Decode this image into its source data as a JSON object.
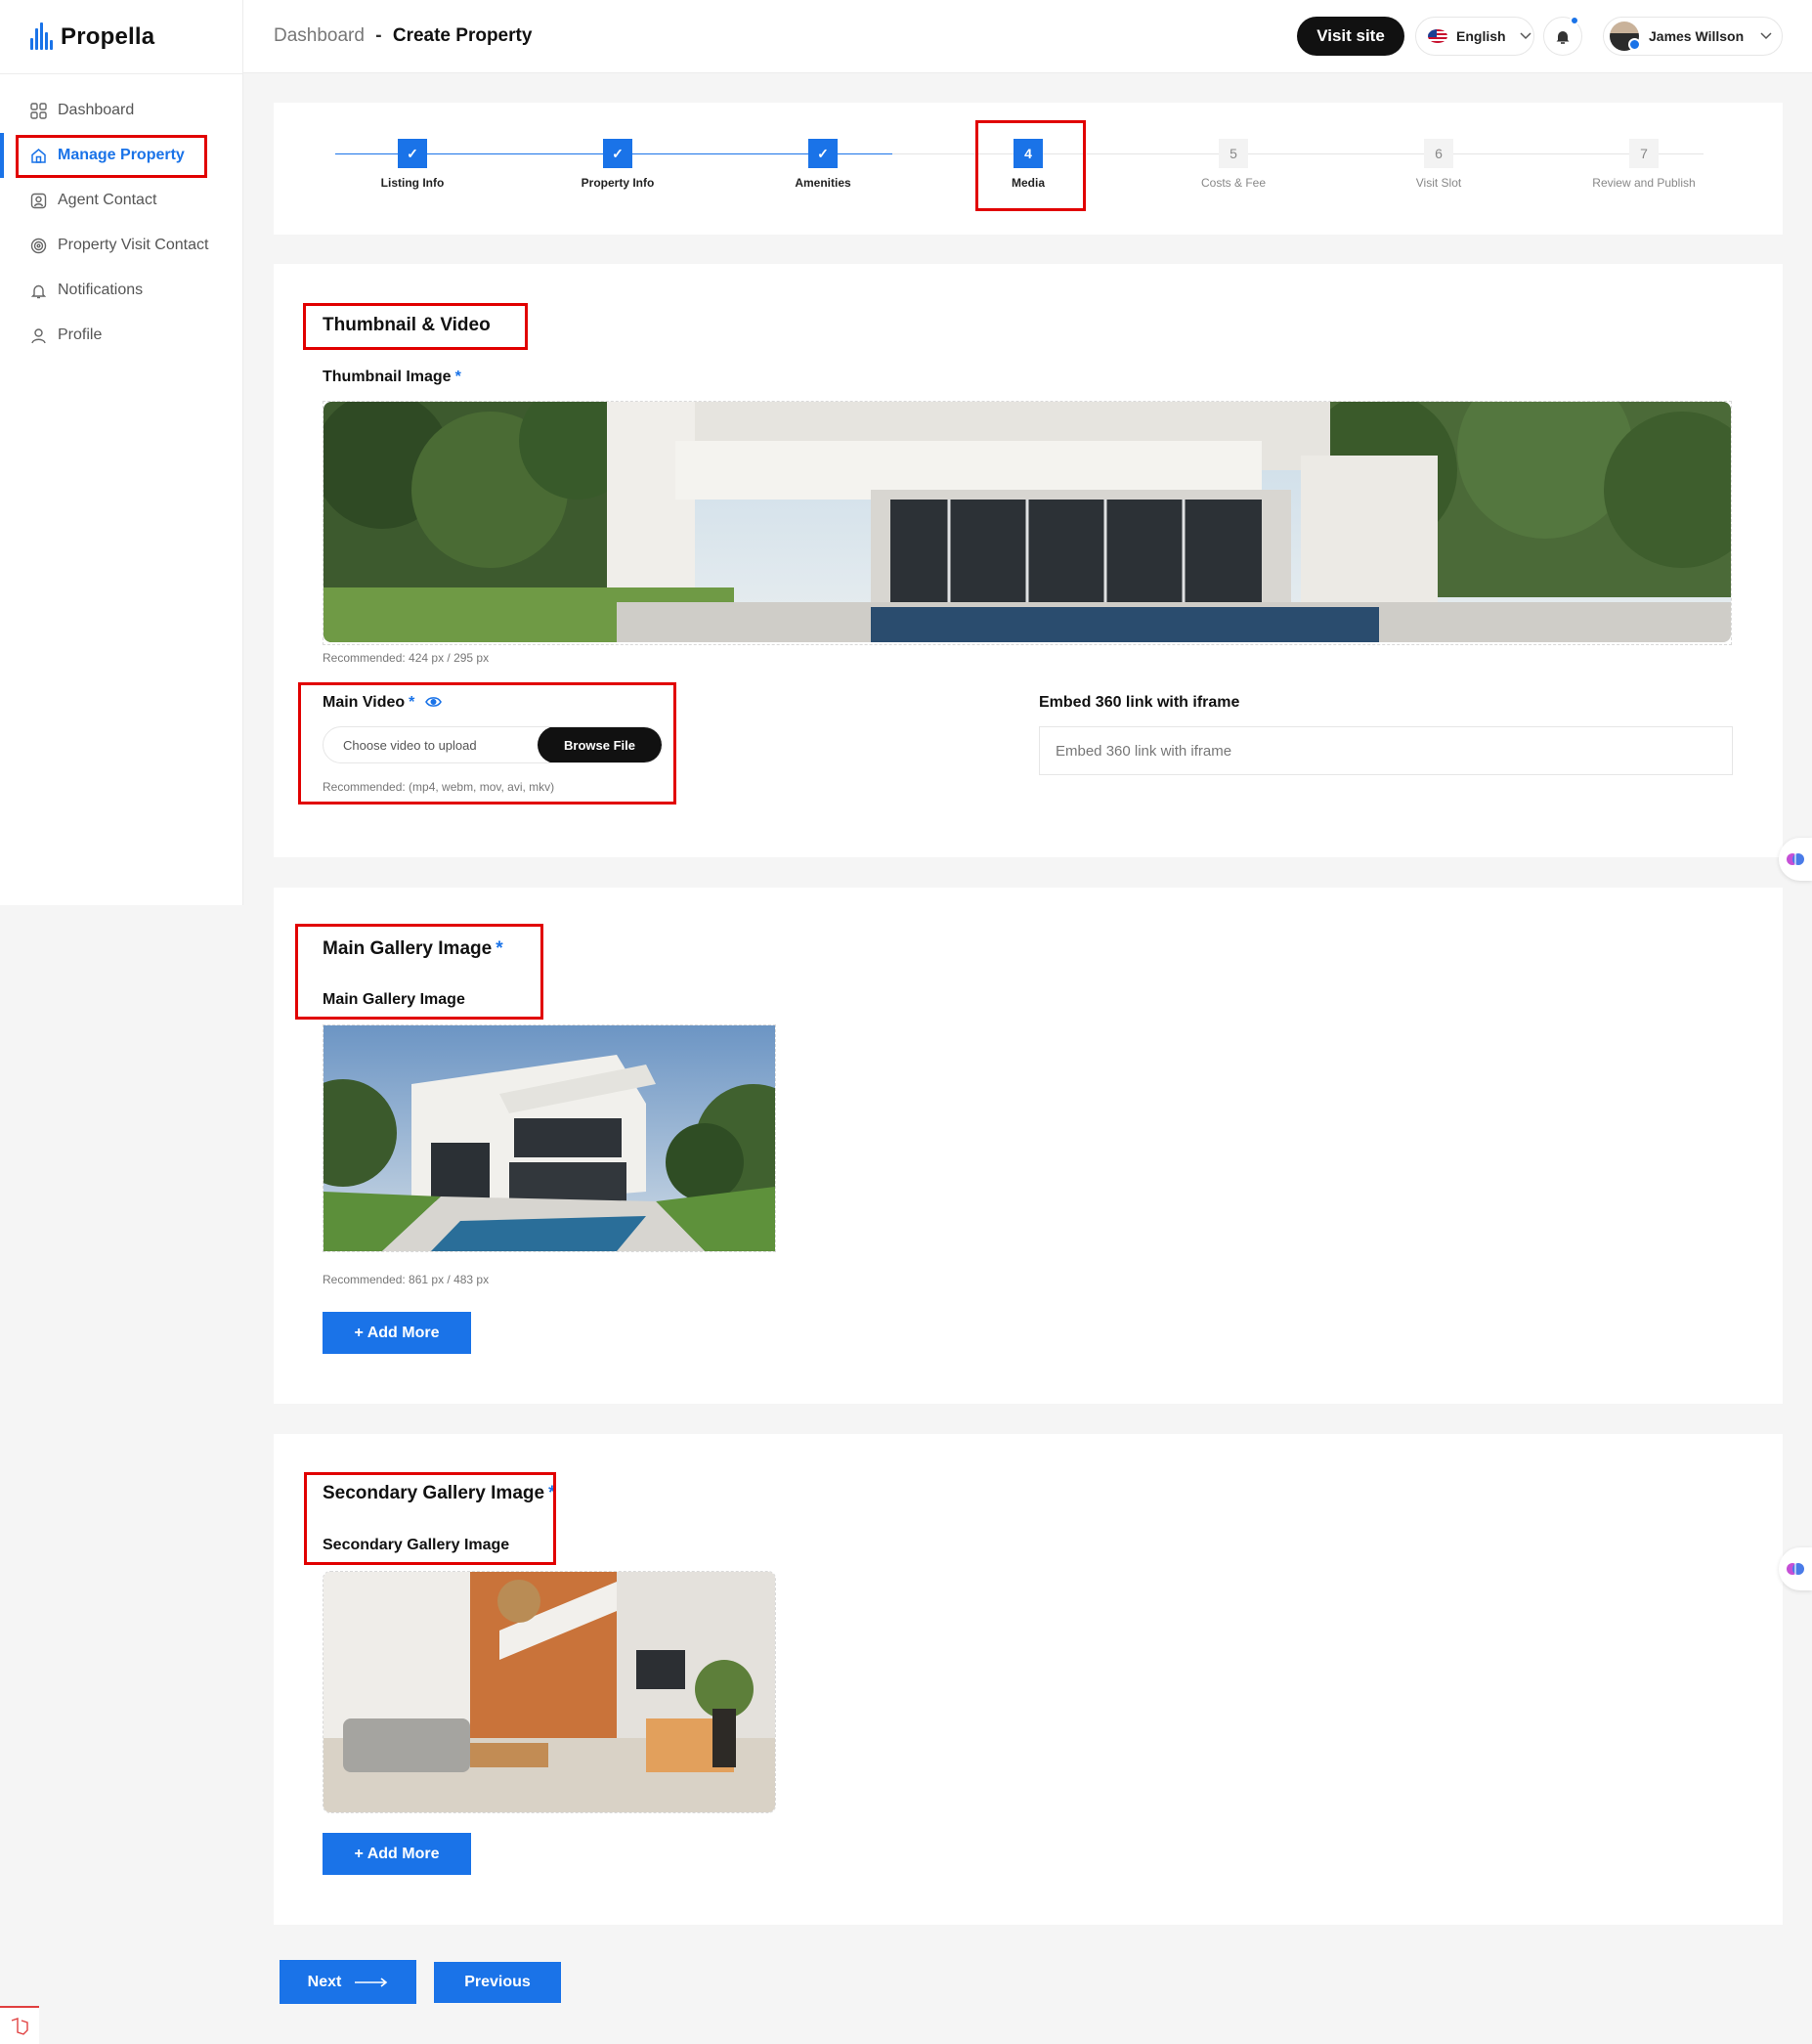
{
  "app": {
    "name": "Propella"
  },
  "sidebar": {
    "items": [
      {
        "label": "Dashboard",
        "icon": "grid-icon"
      },
      {
        "label": "Manage Property",
        "icon": "home-icon",
        "active": true
      },
      {
        "label": "Agent Contact",
        "icon": "contact-icon"
      },
      {
        "label": "Property Visit Contact",
        "icon": "eye-target-icon"
      },
      {
        "label": "Notifications",
        "icon": "bell-icon"
      },
      {
        "label": "Profile",
        "icon": "user-icon"
      }
    ]
  },
  "topbar": {
    "breadcrumb_parent": "Dashboard",
    "breadcrumb_sep": "-",
    "breadcrumb_current": "Create Property",
    "visit_site": "Visit site",
    "language": "English",
    "user_name": "James Willson"
  },
  "stepper": {
    "steps": [
      {
        "label": "Listing Info",
        "marker": "✓",
        "state": "done"
      },
      {
        "label": "Property Info",
        "marker": "✓",
        "state": "done"
      },
      {
        "label": "Amenities",
        "marker": "✓",
        "state": "done"
      },
      {
        "label": "Media",
        "marker": "4",
        "state": "current"
      },
      {
        "label": "Costs & Fee",
        "marker": "5",
        "state": "todo"
      },
      {
        "label": "Visit Slot",
        "marker": "6",
        "state": "todo"
      },
      {
        "label": "Review and Publish",
        "marker": "7",
        "state": "todo"
      }
    ]
  },
  "thumbnail_section": {
    "title": "Thumbnail & Video",
    "thumbnail_label": "Thumbnail Image",
    "required_mark": "*",
    "thumbnail_hint": "Recommended: 424 px / 295 px",
    "video_label": "Main Video",
    "video_placeholder": "Choose video to upload",
    "browse_label": "Browse File",
    "video_hint": "Recommended: (mp4, webm, mov, avi, mkv)",
    "embed_label": "Embed 360 link with iframe",
    "embed_placeholder": "Embed 360 link with iframe"
  },
  "main_gallery": {
    "title": "Main Gallery Image",
    "required_mark": "*",
    "subtitle": "Main Gallery Image",
    "hint": "Recommended: 861 px / 483 px",
    "add_more": "+ Add More"
  },
  "secondary_gallery": {
    "title": "Secondary Gallery Image",
    "required_mark": "*",
    "subtitle": "Secondary Gallery Image",
    "add_more": "+ Add More"
  },
  "footer": {
    "next": "Next",
    "previous": "Previous"
  },
  "colors": {
    "accent": "#1a73e8",
    "highlight_box": "#e10000",
    "dark_button": "#111111"
  }
}
